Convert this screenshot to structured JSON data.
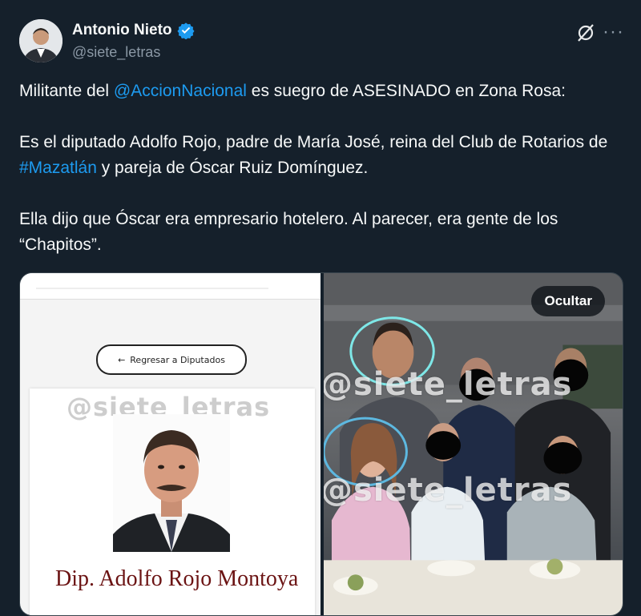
{
  "author": {
    "name": "Antonio Nieto",
    "handle": "@siete_letras",
    "verified": true
  },
  "tweet": {
    "line1_pre": "Militante del ",
    "line1_link": "@AccionNacional",
    "line1_post": " es suegro de ASESINADO en Zona Rosa:",
    "para2_pre": "Es el diputado Adolfo Rojo, padre de María José, reina del Club de Rotarios de ",
    "para2_link": "#Mazatlán",
    "para2_post": " y pareja de Óscar Ruiz Domínguez.",
    "para3": "Ella dijo que Óscar era empresario hotelero. Al parecer, era gente de los “Chapitos”."
  },
  "media": {
    "left": {
      "back_button": "Regresar a Diputados",
      "watermark": "@siete_letras",
      "dip_name": "Dip. Adolfo Rojo Montoya"
    },
    "right": {
      "hide_button": "Ocultar",
      "watermark1": "@siete_letras",
      "watermark2": "@siete_letras"
    }
  },
  "colors": {
    "background": "#15202b",
    "link": "#1d9bf0",
    "text": "#f7f9f9",
    "secondary": "#8b98a5"
  }
}
